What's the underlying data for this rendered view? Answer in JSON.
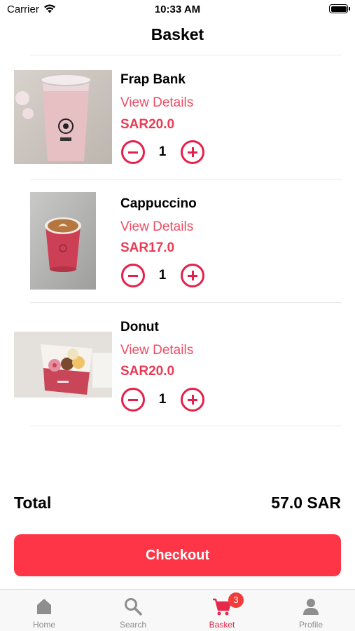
{
  "status_bar": {
    "carrier": "Carrier",
    "time": "10:33 AM"
  },
  "header": {
    "title": "Basket"
  },
  "items": [
    {
      "name": "Frap Bank",
      "details_label": "View Details",
      "price": "SAR20.0",
      "quantity": "1",
      "image": "frappe-cup-photo"
    },
    {
      "name": "Cappuccino",
      "details_label": "View Details",
      "price": "SAR17.0",
      "quantity": "1",
      "image": "cappuccino-cup-photo"
    },
    {
      "name": "Donut",
      "details_label": "View Details",
      "price": "SAR20.0",
      "quantity": "1",
      "image": "donut-box-photo"
    }
  ],
  "summary": {
    "total_label": "Total",
    "total_value": "57.0 SAR"
  },
  "checkout": {
    "label": "Checkout"
  },
  "tab_bar": {
    "tabs": [
      {
        "label": "Home",
        "icon": "home-icon"
      },
      {
        "label": "Search",
        "icon": "search-icon"
      },
      {
        "label": "Basket",
        "icon": "cart-icon",
        "badge": "3",
        "active": true
      },
      {
        "label": "Profile",
        "icon": "profile-icon"
      }
    ]
  },
  "colors": {
    "accent": "#e6204a",
    "price": "#e93b54",
    "checkout": "#fd3547",
    "badge": "#f23b3b"
  }
}
